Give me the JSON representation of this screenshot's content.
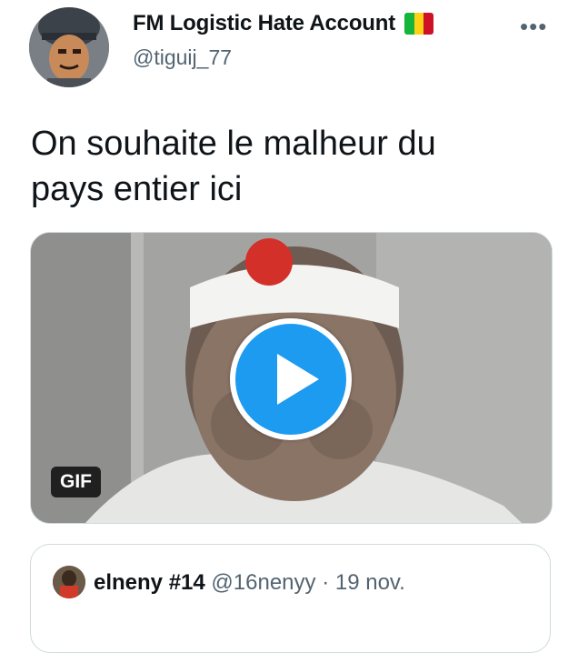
{
  "tweet": {
    "display_name": "FM Logistic Hate Account",
    "flag_colors": [
      "#14b53a",
      "#fcd116",
      "#ce1126"
    ],
    "handle": "@tiguij_77",
    "more_icon": "•••",
    "text_line1": "On souhaite le malheur du",
    "text_line2": "pays entier ici",
    "media": {
      "badge": "GIF",
      "play_icon": "play-icon"
    }
  },
  "quoted_tweet": {
    "display_name": "elneny #14",
    "handle": "@16nenyy",
    "separator": "·",
    "date": "19 nov."
  },
  "colors": {
    "accent": "#1d9bf0",
    "text_primary": "#0f1419",
    "text_secondary": "#536471",
    "border": "#cfd9de"
  }
}
